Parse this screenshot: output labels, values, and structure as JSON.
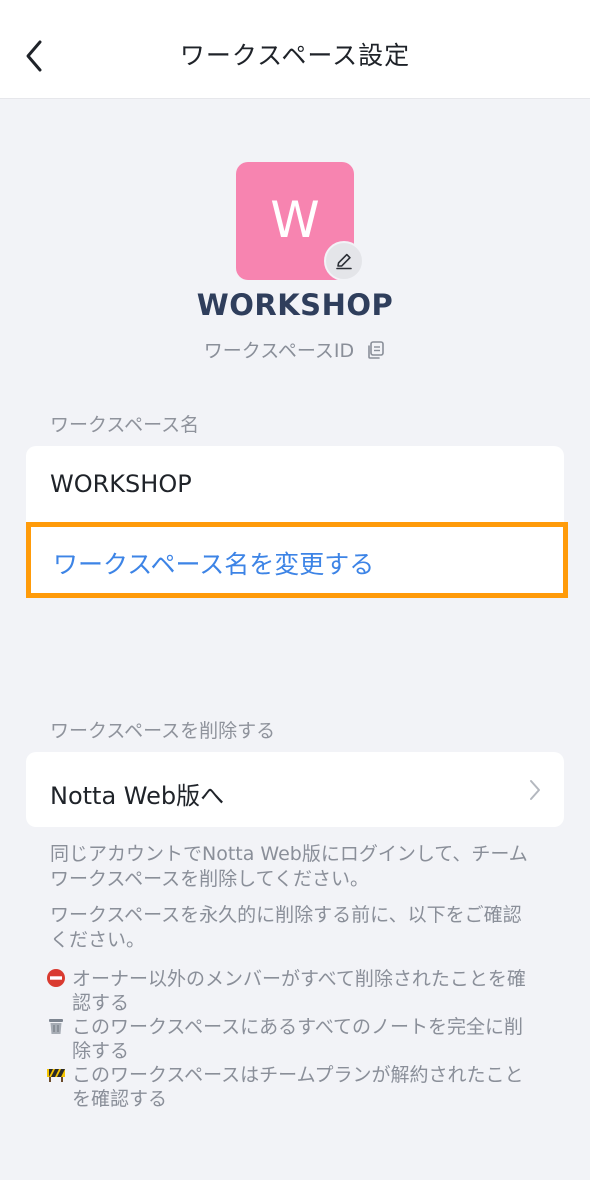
{
  "nav": {
    "title": "ワークスペース設定"
  },
  "workspace": {
    "avatar_letter": "W",
    "name": "WORKSHOP",
    "id_label": "ワークスペースID"
  },
  "name_section": {
    "label": "ワークスペース名",
    "value": "WORKSHOP",
    "rename_action": "ワークスペース名を変更する"
  },
  "delete_section": {
    "label": "ワークスペースを削除する",
    "web_link": "Notta Web版へ",
    "info1_line1": "同じアカウントでNotta Web版にログインして、チーム",
    "info1_line2": "ワークスペースを削除してください。",
    "info2_line1": "ワークスペースを永久的に削除する前に、以下をご確認",
    "info2_line2": "ください。",
    "checklist": [
      {
        "icon": "no-entry-icon",
        "line1": "オーナー以外のメンバーがすべて削除されたことを確",
        "line2": "認する"
      },
      {
        "icon": "trash-icon",
        "line1": "このワークスペースにあるすべてのノートを完全に削",
        "line2": "除する"
      },
      {
        "icon": "construction-icon",
        "line1": "このワークスペースはチームプランが解約されたこと",
        "line2": "を確認する"
      }
    ]
  },
  "colors": {
    "accent": "#3d84e6",
    "highlight": "#ff9b0a",
    "avatar": "#f784b0",
    "background": "#f2f3f7"
  }
}
